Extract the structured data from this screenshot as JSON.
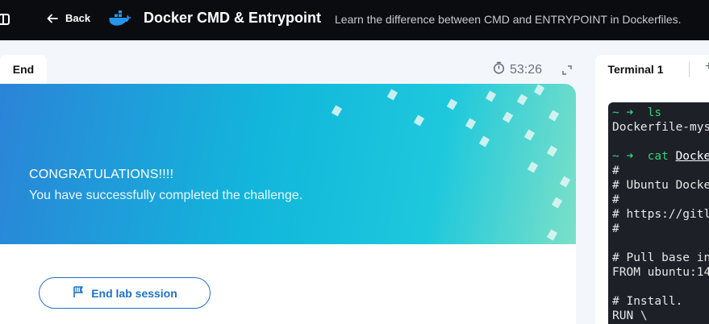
{
  "header": {
    "back_label": "Back",
    "title": "Docker CMD & Entrypoint",
    "subtitle": "Learn the difference between CMD and ENTRYPOINT in Dockerfiles."
  },
  "left_panel": {
    "tab_label": "End",
    "timer": "53:26",
    "banner": {
      "title": "CONGRATULATIONS!!!!",
      "message": "You have successfully completed the challenge."
    },
    "end_button_label": "End lab session"
  },
  "right_panel": {
    "tab_label": "Terminal 1",
    "add_tab_symbol": "+",
    "terminal_lines": [
      {
        "prompt": "~ ➜  ",
        "cmd": "ls"
      },
      {
        "text": "Dockerfile-mys"
      },
      {
        "text": ""
      },
      {
        "prompt": "~ ➜  ",
        "cmd": "cat ",
        "cmd_underline": "Docke"
      },
      {
        "text": "#"
      },
      {
        "text": "# Ubuntu Docke"
      },
      {
        "text": "#"
      },
      {
        "text": "# https://gitl"
      },
      {
        "text": "#"
      },
      {
        "text": ""
      },
      {
        "text": "# Pull base in"
      },
      {
        "text": "FROM ubuntu:14"
      },
      {
        "text": ""
      },
      {
        "text": "# Install."
      },
      {
        "text": "RUN \\"
      }
    ]
  },
  "colors": {
    "topbar": "#0b0c0f",
    "accent": "#1e72c8",
    "terminal_bg": "#1d2027",
    "prompt_green": "#33d17a"
  }
}
